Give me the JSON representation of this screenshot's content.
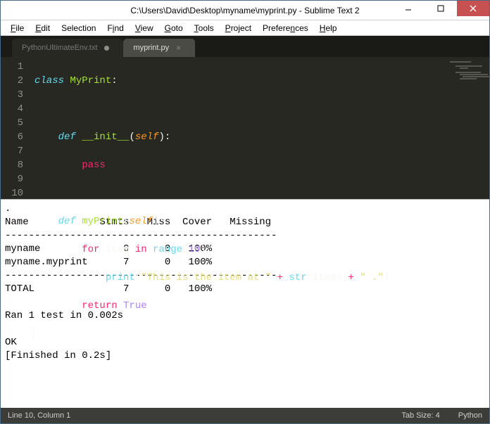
{
  "window": {
    "title": "C:\\Users\\David\\Desktop\\myname\\myprint.py - Sublime Text 2"
  },
  "menu": {
    "file": "File",
    "edit": "Edit",
    "selection": "Selection",
    "find": "Find",
    "view": "View",
    "goto": "Goto",
    "tools": "Tools",
    "project": "Project",
    "preferences": "Preferences",
    "help": "Help"
  },
  "tabs": [
    {
      "label": "PythonUltimateEnv.txt",
      "dirty": true,
      "active": false
    },
    {
      "label": "myprint.py",
      "dirty": false,
      "active": true
    }
  ],
  "gutter_lines": [
    "1",
    "2",
    "3",
    "4",
    "5",
    "6",
    "7",
    "8",
    "9",
    "10"
  ],
  "code": {
    "l1": {
      "kw": "class ",
      "name": "MyPrint",
      "rest": ":"
    },
    "l2": "",
    "l3": {
      "indent": "    ",
      "kw": "def ",
      "fn": "__init__",
      "paren_o": "(",
      "self": "self",
      "paren_c": "):"
    },
    "l4": {
      "indent": "        ",
      "ctrl": "pass"
    },
    "l5": "",
    "l6": {
      "indent": "    ",
      "kw": "def ",
      "fn": "myPrint",
      "paren_o": "(",
      "self": "self",
      "paren_c": "):"
    },
    "l7": {
      "indent": "        ",
      "ctrl": "for ",
      "var": "item",
      "ctrl2": " in ",
      "fn": "range",
      "paren_o": "(",
      "num": "10",
      "paren_c": "):"
    },
    "l8": {
      "indent": "            ",
      "fn": "print",
      "paren_o": "(",
      "str1": "\"This is the item at \"",
      "op1": " + ",
      "cast": "str",
      "po2": "(",
      "var": "item",
      "pc2": ")",
      "op2": " + ",
      "str2": "\" .\"",
      "paren_c": ")"
    },
    "l9": {
      "indent": "        ",
      "ctrl": "return ",
      "num": "True"
    },
    "l10": ""
  },
  "console": {
    "text": ".\nName            Stmts   Miss  Cover   Missing\n----------------------------------------------\nmyname              0      0   100%\nmyname.myprint      7      0   100%\n----------------------------------------------\nTOTAL               7      0   100%\n\nRan 1 test in 0.002s\n\nOK\n[Finished in 0.2s]"
  },
  "status": {
    "position": "Line 10, Column 1",
    "tabsize": "Tab Size: 4",
    "syntax": "Python"
  }
}
